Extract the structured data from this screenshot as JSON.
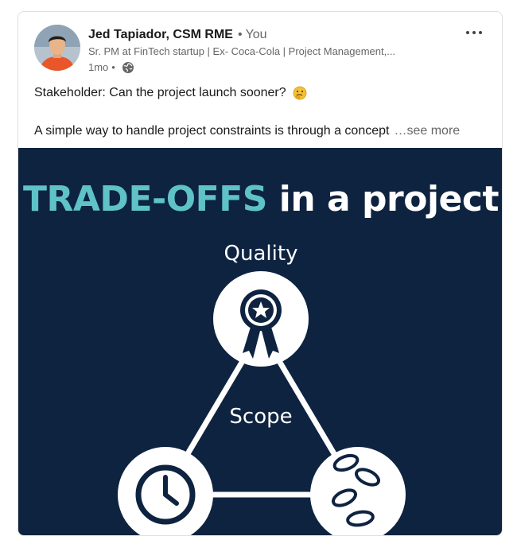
{
  "post": {
    "author": {
      "name": "Jed Tapiador, CSM RME",
      "separator": "•",
      "relation": "You",
      "headline": "Sr. PM at FinTech startup | Ex- Coca-Cola | Project Management,...",
      "time": "1mo",
      "time_sep": "•",
      "visibility_icon": "globe-icon"
    },
    "more_icon": "more-horizontal-icon",
    "text": {
      "line1": "Stakeholder: Can the project launch sooner?",
      "line1_emoji": "thinking-face-emoji",
      "line2": "A simple way to handle project constraints is through a concept",
      "see_more": "…see more"
    },
    "image": {
      "title_accent": "TRADE-OFFS",
      "title_rest": " in a project",
      "labels": {
        "top": "Quality",
        "center": "Scope"
      },
      "icons": [
        "award-ribbon-icon",
        "clock-icon",
        "coins-icon"
      ],
      "colors": {
        "background": "#0e2340",
        "accent": "#5fc2c7",
        "foreground": "#ffffff"
      }
    }
  }
}
